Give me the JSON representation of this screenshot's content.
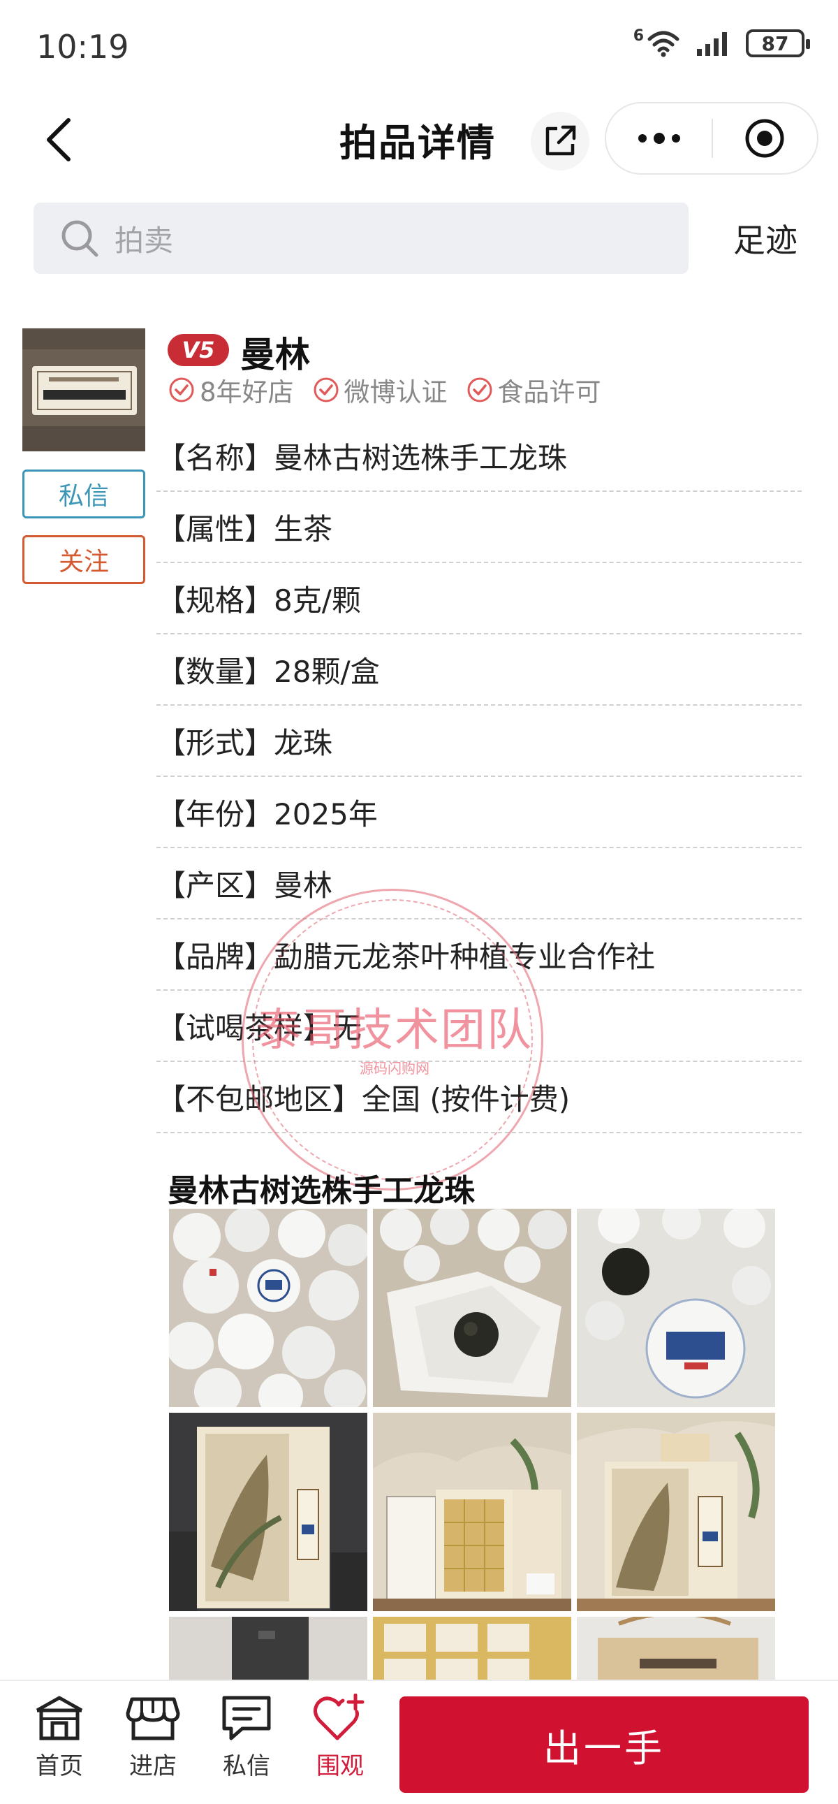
{
  "status_bar": {
    "time": "10:19",
    "network": "6",
    "battery": "87"
  },
  "nav": {
    "title": "拍品详情"
  },
  "search": {
    "placeholder": "拍卖",
    "footprint_label": "足迹"
  },
  "seller": {
    "level_badge": "V5",
    "name": "曼林",
    "certifications": [
      "8年好店",
      "微博认证",
      "食品许可"
    ],
    "message_button": "私信",
    "follow_button": "关注"
  },
  "attributes": [
    {
      "key": "【名称】",
      "value": "曼林古树选株手工龙珠"
    },
    {
      "key": "【属性】",
      "value": "生茶"
    },
    {
      "key": "【规格】",
      "value": "8克/颗"
    },
    {
      "key": "【数量】",
      "value": "28颗/盒"
    },
    {
      "key": "【形式】",
      "value": "龙珠"
    },
    {
      "key": "【年份】",
      "value": "2025年"
    },
    {
      "key": "【产区】",
      "value": "曼林"
    },
    {
      "key": "【品牌】",
      "value": "勐腊元龙茶叶种植专业合作社"
    },
    {
      "key": "【试喝茶样】",
      "value": "无"
    },
    {
      "key": "【不包邮地区】",
      "value": "全国 (按件计费)"
    }
  ],
  "watermark": {
    "main": "泰哥技术团队",
    "sub": "源码闪购网"
  },
  "gallery": {
    "title": "曼林古树选株手工龙珠"
  },
  "bottom_bar": {
    "tabs": [
      "首页",
      "进店",
      "私信",
      "围观"
    ],
    "bid_button": "出一手"
  },
  "colors": {
    "accent_red": "#d0112f",
    "message_blue": "#3b95b7",
    "follow_orange": "#d45a32"
  }
}
